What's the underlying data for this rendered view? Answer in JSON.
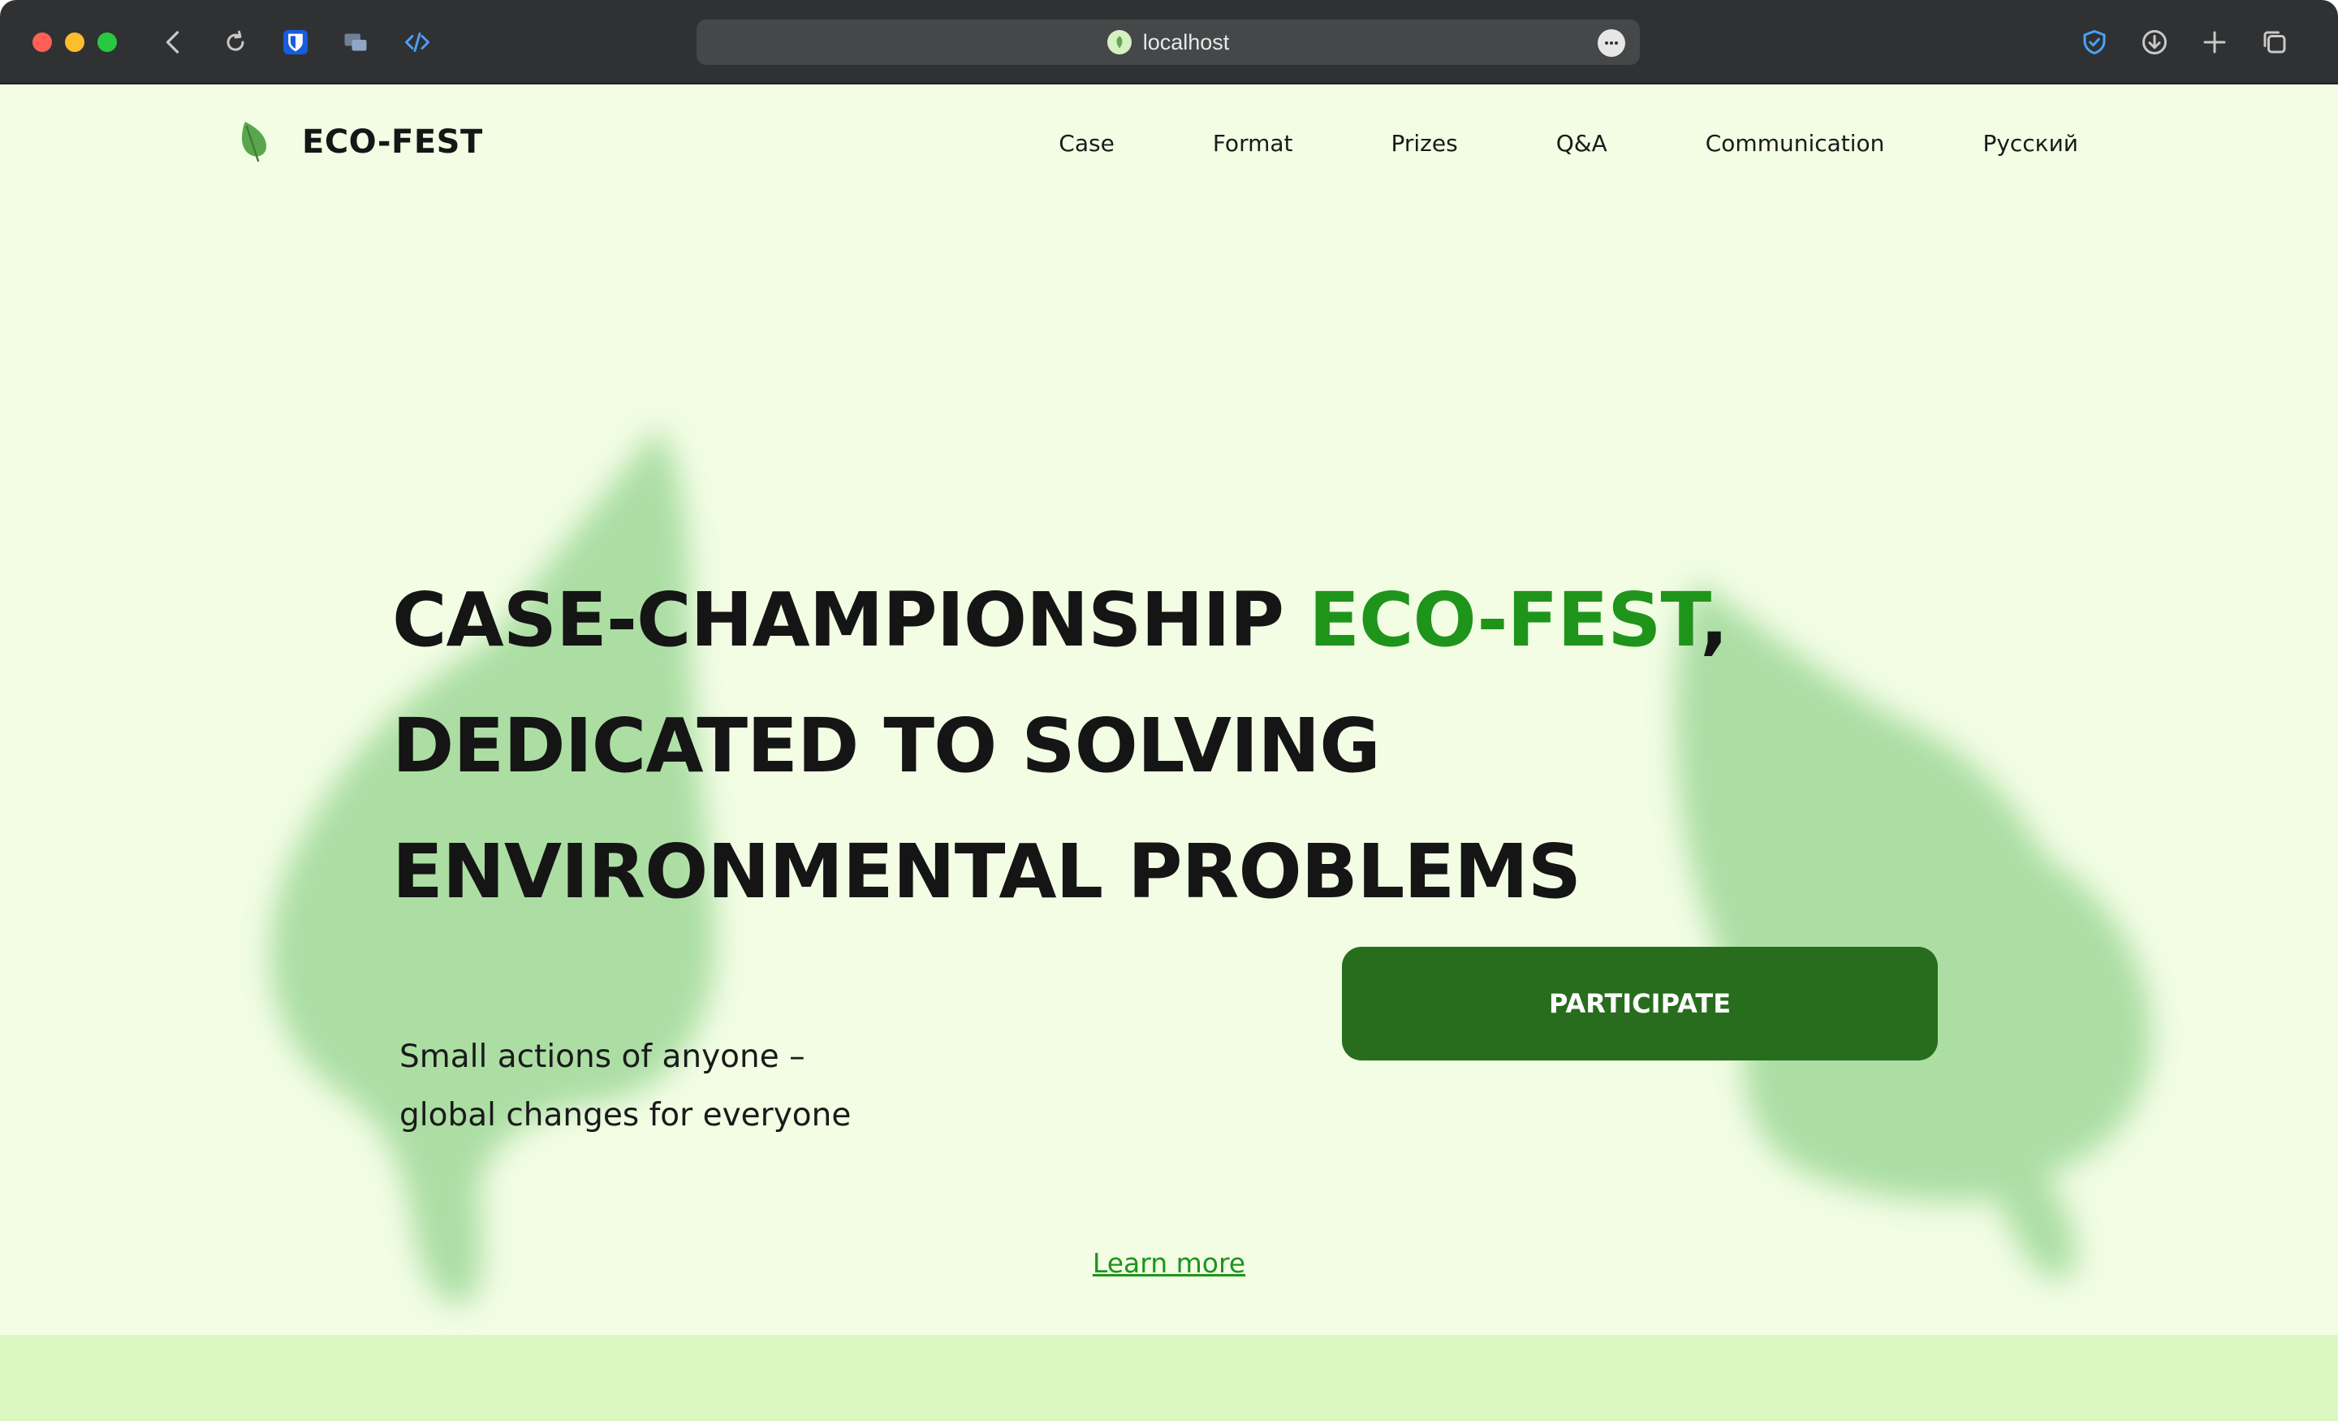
{
  "browser": {
    "url": "localhost",
    "colors": {
      "chrome_bg": "#2f3133",
      "urlbar_bg": "#454749"
    },
    "icons": [
      "back-icon",
      "reload-icon",
      "bitwarden-icon",
      "screens-icon",
      "devtools-icon",
      "shield-icon",
      "download-icon",
      "new-tab-icon",
      "tabs-overview-icon"
    ]
  },
  "site": {
    "logo_text": "ECO-FEST",
    "nav": {
      "items": [
        "Case",
        "Format",
        "Prizes",
        "Q&A",
        "Communication",
        "Русский"
      ]
    },
    "hero": {
      "title_part1": "CASE-CHAMPIONSHIP ",
      "title_accent": "ECO-FEST",
      "title_part2": ",",
      "title_line2": "DEDICATED TO SOLVING",
      "title_line3": "ENVIRONMENTAL PROBLEMS",
      "tagline_line1": "Small actions of anyone –",
      "tagline_line2": "global changes for everyone",
      "cta_label": "PARTICIPATE",
      "learn_more": "Learn more"
    },
    "colors": {
      "page_bg": "#f2fde4",
      "accent_green": "#1f941b",
      "button_green": "#276d1d",
      "leaf_blur": "#a8dca0",
      "bottom_band": "#dcf8c2"
    }
  }
}
